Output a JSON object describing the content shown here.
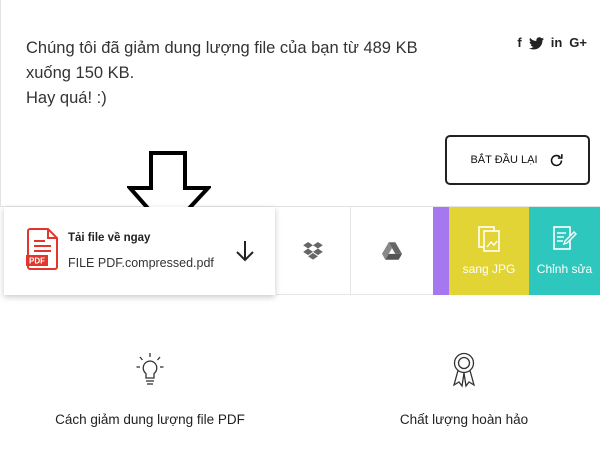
{
  "result": {
    "line1": "Chúng tôi đã giảm dung lượng file của bạn từ 489 KB",
    "line2": "xuống 150 KB.",
    "line3": "Hay quá! :)"
  },
  "social": {
    "facebook": "f",
    "linkedin": "in",
    "google_plus": "G+"
  },
  "restart": {
    "label": "BẮT ĐẦU LẠI"
  },
  "download": {
    "title": "Tải file về ngay",
    "filename": "FILE PDF.compressed.pdf",
    "pdf_badge": "PDF"
  },
  "tools": {
    "to_jpg_label": "sang JPG",
    "edit_label": "Chỉnh sửa"
  },
  "features": {
    "left_title": "Cách giảm dung lượng file PDF",
    "right_title": "Chất lượng hoàn hảo"
  },
  "colors": {
    "pdf_red": "#e2352b",
    "purple": "#a678f0",
    "yellow": "#e3d436",
    "teal": "#2ec7bd"
  }
}
